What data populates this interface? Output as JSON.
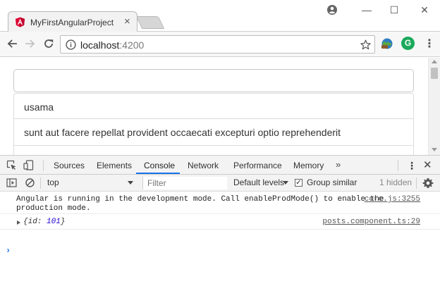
{
  "browser": {
    "tab_title": "MyFirstAngularProject",
    "tab_close": "×",
    "window_buttons": {
      "minimize": "—",
      "maximize": "☐",
      "close": "✕"
    },
    "url_host": "localhost",
    "url_port": ":4200",
    "extension_g": "G",
    "menu": "⋮"
  },
  "page": {
    "search": {
      "value": "",
      "placeholder": ""
    },
    "items": [
      {
        "title": "usama"
      },
      {
        "title": "sunt aut facere repellat provident occaecati excepturi optio reprehenderit"
      },
      {
        "title": ""
      }
    ]
  },
  "devtools": {
    "tabs": [
      "Sources",
      "Elements",
      "Console",
      "Network",
      "Performance",
      "Memory"
    ],
    "active_tab": "Console",
    "more": "»",
    "kebab": "⋮",
    "close": "✕",
    "context": "top",
    "filter_placeholder": "Filter",
    "levels": "Default levels",
    "group_similar": "Group similar",
    "group_similar_checked": true,
    "check_mark": "✓",
    "hidden_count": "1 hidden",
    "messages": [
      {
        "text": "Angular is running in the development mode. Call enableProdMode() to enable the\nproduction mode.",
        "source": "core.js:3255"
      },
      {
        "object_open": "{id: ",
        "object_value": "101",
        "object_close": "}",
        "source": "posts.component.ts:29"
      }
    ],
    "prompt": "›"
  },
  "colors": {
    "accent": "#1a73e8",
    "angular_red": "#dd0031",
    "grammarly_green": "#19a95b"
  }
}
